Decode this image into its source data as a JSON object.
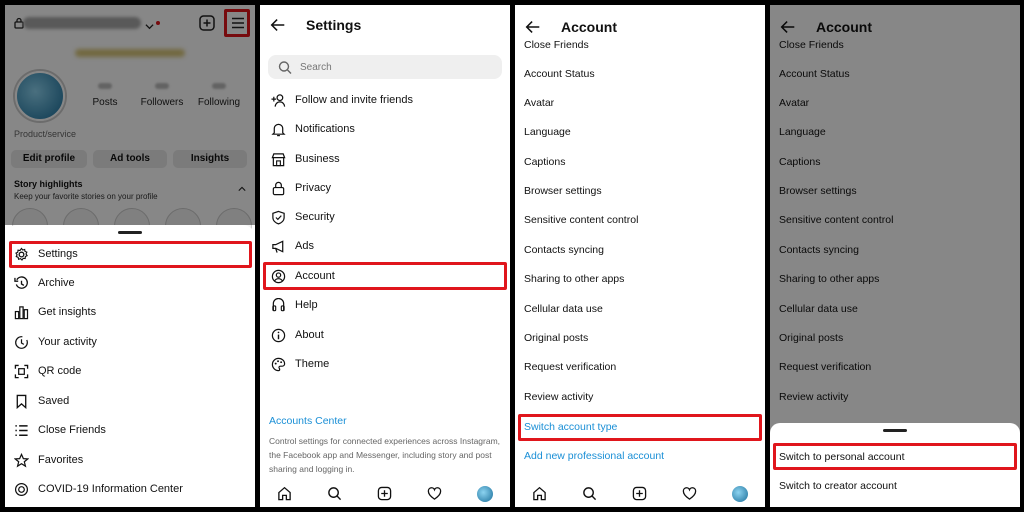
{
  "panel1": {
    "profile": {
      "stats": [
        "Posts",
        "Followers",
        "Following"
      ],
      "category": "Product/service",
      "buttons": [
        "Edit profile",
        "Ad tools",
        "Insights"
      ],
      "story_title": "Story highlights",
      "story_sub": "Keep your favorite stories on your profile"
    },
    "menu": [
      {
        "label": "Settings",
        "icon": "gear-icon"
      },
      {
        "label": "Archive",
        "icon": "archive-icon"
      },
      {
        "label": "Get insights",
        "icon": "insights-icon"
      },
      {
        "label": "Your activity",
        "icon": "activity-icon"
      },
      {
        "label": "QR code",
        "icon": "qr-icon"
      },
      {
        "label": "Saved",
        "icon": "bookmark-icon"
      },
      {
        "label": "Close Friends",
        "icon": "list-icon"
      },
      {
        "label": "Favorites",
        "icon": "star-icon"
      },
      {
        "label": "COVID-19 Information Center",
        "icon": "covid-icon"
      }
    ]
  },
  "panel2": {
    "title": "Settings",
    "search_placeholder": "Search",
    "items": [
      {
        "label": "Follow and invite friends",
        "icon": "add-person-icon"
      },
      {
        "label": "Notifications",
        "icon": "bell-icon"
      },
      {
        "label": "Business",
        "icon": "store-icon"
      },
      {
        "label": "Privacy",
        "icon": "lock-icon"
      },
      {
        "label": "Security",
        "icon": "shield-icon"
      },
      {
        "label": "Ads",
        "icon": "megaphone-icon"
      },
      {
        "label": "Account",
        "icon": "account-icon"
      },
      {
        "label": "Help",
        "icon": "help-icon"
      },
      {
        "label": "About",
        "icon": "info-icon"
      },
      {
        "label": "Theme",
        "icon": "palette-icon"
      }
    ],
    "accounts_center": "Accounts Center",
    "accounts_center_desc": "Control settings for connected experiences across Instagram, the Facebook app and Messenger, including story and post sharing and logging in."
  },
  "panel3": {
    "title": "Account",
    "items": [
      "Close Friends",
      "Account Status",
      "Avatar",
      "Language",
      "Captions",
      "Browser settings",
      "Sensitive content control",
      "Contacts syncing",
      "Sharing to other apps",
      "Cellular data use",
      "Original posts",
      "Request verification",
      "Review activity"
    ],
    "switch_type": "Switch account type",
    "add_pro": "Add new professional account"
  },
  "panel4": {
    "title": "Account",
    "items": [
      "Close Friends",
      "Account Status",
      "Avatar",
      "Language",
      "Captions",
      "Browser settings",
      "Sensitive content control",
      "Contacts syncing",
      "Sharing to other apps",
      "Cellular data use",
      "Original posts",
      "Request verification",
      "Review activity"
    ],
    "sheet_options": [
      "Switch to personal account",
      "Switch to creator account"
    ]
  },
  "colors": {
    "highlight": "#e0161c",
    "link": "#1a8fd6"
  }
}
